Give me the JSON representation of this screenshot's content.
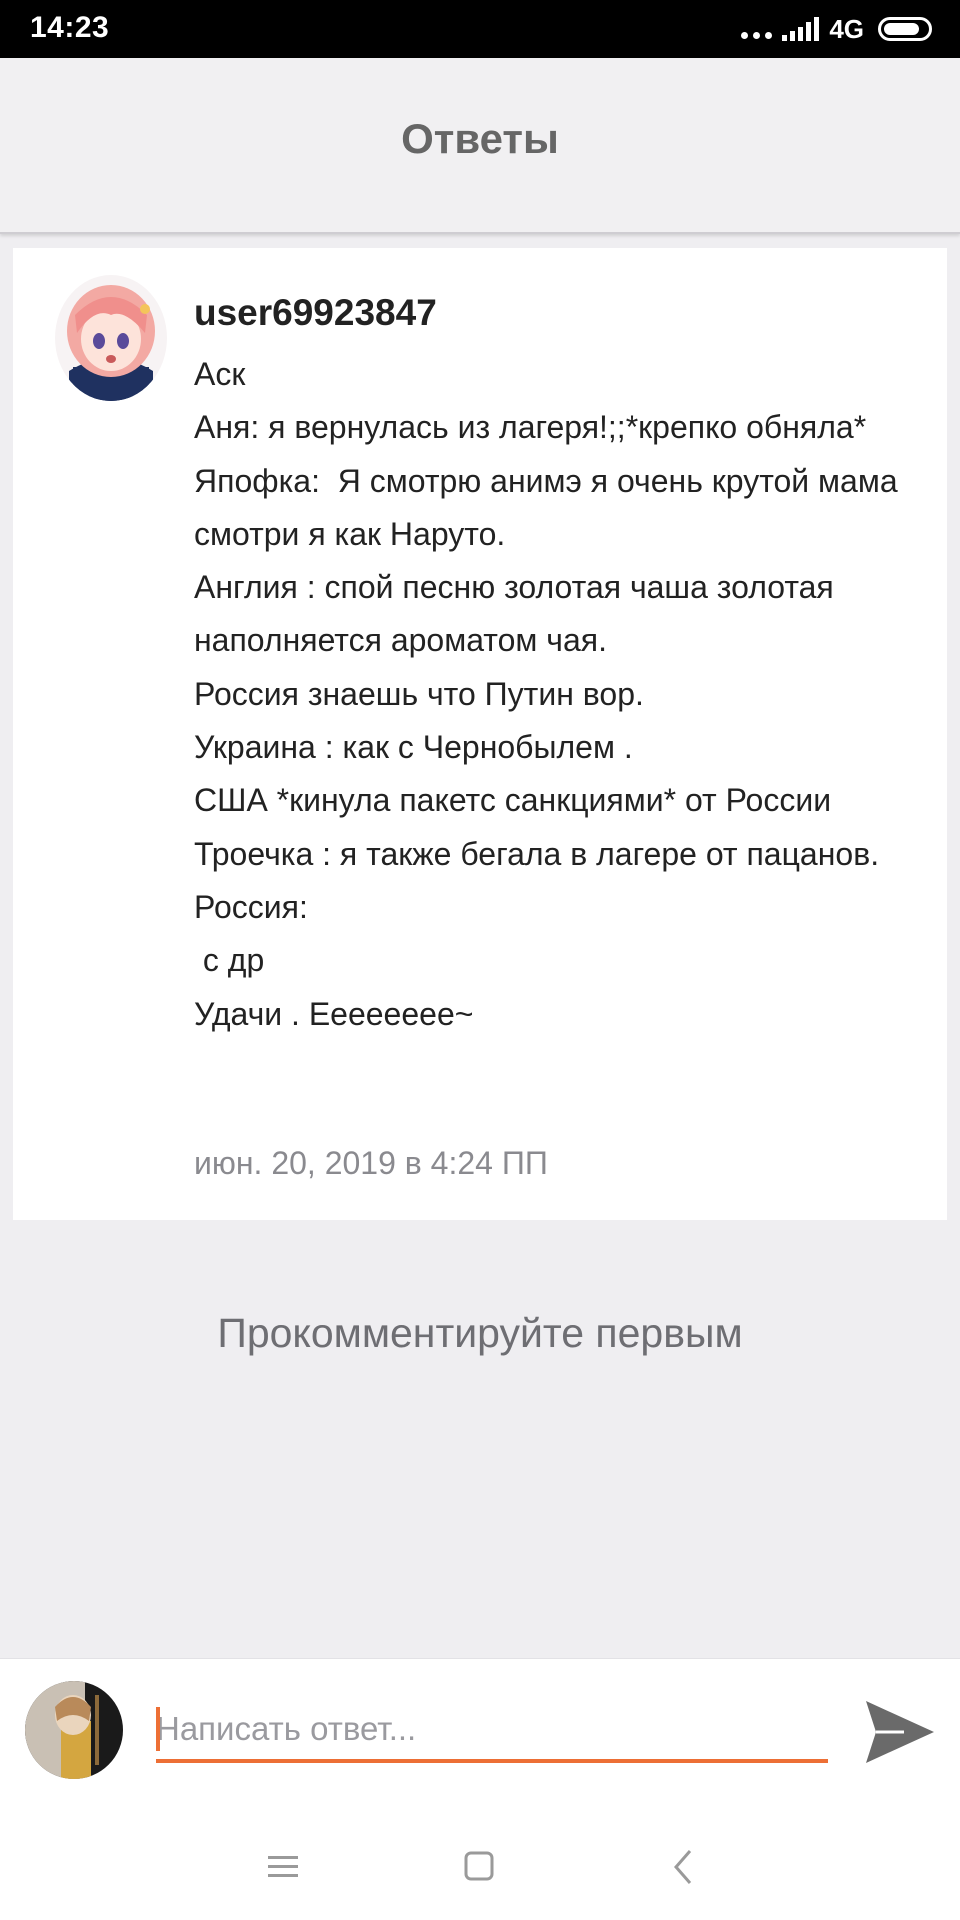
{
  "status_bar": {
    "time": "14:23",
    "network": "4G",
    "icons": [
      "notification-dots-icon",
      "signal-icon",
      "battery-icon"
    ]
  },
  "header": {
    "title": "Ответы"
  },
  "post": {
    "username": "user69923847",
    "avatar": "avatar-anime-girl",
    "lines": [
      "Аск",
      "Аня: я вернулась из лагеря!;;*крепко обняла*",
      "Япофка:  Я смотрю анимэ я очень крутой мама смотри я как Наруто.",
      "Англия : спой песню золотая чаша золотая наполняется ароматом чая.",
      "Россия знаешь что Путин вор.",
      "Украина : как с Чернобылем .",
      "США *кинула пакетс санкциями* от России",
      "Троечка : я также бегала в лагере от пацанов.",
      "Россия:",
      " с др",
      "Удачи . Еееееeee~"
    ],
    "timestamp": "июн. 20, 2019 в 4:24 ПП"
  },
  "comments": {
    "empty_text": "Прокомментируйте первым"
  },
  "reply": {
    "placeholder": "Написать ответ...",
    "value": "",
    "accent_color": "#ed6f35"
  },
  "nav": {
    "icons": [
      "menu-icon",
      "home-icon",
      "back-icon"
    ]
  }
}
